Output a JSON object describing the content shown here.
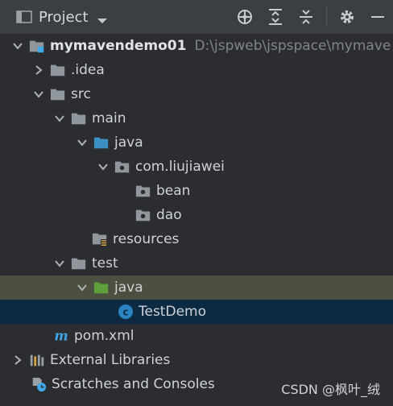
{
  "header": {
    "title": "Project",
    "icons": [
      "project-view-icon",
      "locate-icon",
      "expand-all-icon",
      "collapse-all-icon",
      "settings-gear-icon",
      "hide-minus-icon"
    ]
  },
  "tree": {
    "root_name": "mymavendemo01",
    "root_path": "D:\\jspweb\\jspspace\\mymave",
    "items": [
      {
        "label": "mymavendemo01"
      },
      {
        "label": ".idea"
      },
      {
        "label": "src"
      },
      {
        "label": "main"
      },
      {
        "label": "java"
      },
      {
        "label": "com.liujiawei"
      },
      {
        "label": "bean"
      },
      {
        "label": "dao"
      },
      {
        "label": "resources"
      },
      {
        "label": "test"
      },
      {
        "label": "java"
      },
      {
        "label": "TestDemo"
      },
      {
        "label": "pom.xml"
      },
      {
        "label": "External Libraries"
      },
      {
        "label": "Scratches and Consoles"
      }
    ]
  },
  "watermark": "CSDN @枫叶_绒",
  "colors": {
    "folder": "#8f969c",
    "java_folder": "#3b8fc4",
    "test_folder": "#5e9f3a",
    "class_icon": "#2c83c2",
    "maven": "#3fa7e8"
  }
}
